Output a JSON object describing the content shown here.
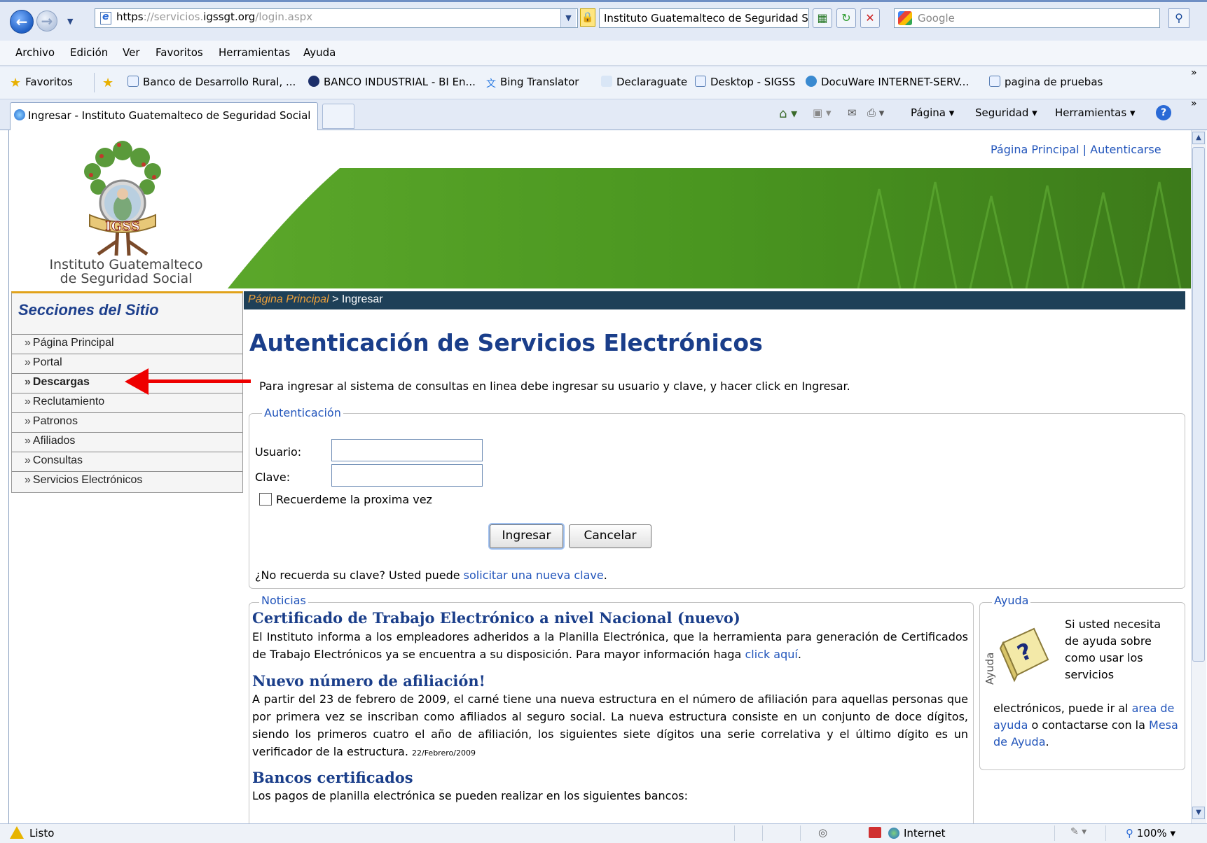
{
  "browser": {
    "address": {
      "scheme": "https",
      "sep": "://",
      "host_prefix": "servicios.",
      "domain": "igssgt.org",
      "path": "/login.aspx"
    },
    "site_title": "Instituto Guatemalteco de Seguridad S...",
    "search_placeholder": "Google",
    "menu": [
      "Archivo",
      "Edición",
      "Ver",
      "Favoritos",
      "Herramientas",
      "Ayuda"
    ],
    "favorites_label": "Favoritos",
    "favorites": [
      "Banco de Desarrollo Rural, ...",
      "BANCO INDUSTRIAL - BI En...",
      "Bing Translator",
      "Declaraguate",
      "Desktop - SIGSS",
      "DocuWare INTERNET-SERV...",
      "pagina de pruebas"
    ],
    "tab_title": "Ingresar - Instituto Guatemalteco de Seguridad Social",
    "commands": {
      "pagina": "Página ▾",
      "seguridad": "Seguridad ▾",
      "herramientas": "Herramientas ▾"
    },
    "status": {
      "text": "Listo",
      "zone": "Internet",
      "zoom": "100%"
    }
  },
  "header": {
    "logo_text": "IGSS",
    "org_name_line1": "Instituto Guatemalteco",
    "org_name_line2": "de Seguridad Social",
    "top_link_home": "Página Principal",
    "top_link_sep": "|",
    "top_link_auth": "Autenticarse"
  },
  "sidebar": {
    "title": "Secciones del Sitio",
    "marker": "»",
    "items": [
      {
        "label": "Página Principal",
        "bold": false
      },
      {
        "label": "Portal",
        "bold": false
      },
      {
        "label": "Descargas",
        "bold": true
      },
      {
        "label": "Reclutamiento",
        "bold": false
      },
      {
        "label": "Patronos",
        "bold": false
      },
      {
        "label": "Afiliados",
        "bold": false
      },
      {
        "label": "Consultas",
        "bold": false
      },
      {
        "label": "Servicios Electrónicos",
        "bold": false
      }
    ]
  },
  "breadcrumb": {
    "home": "Página Principal",
    "sep": ">",
    "current": "Ingresar"
  },
  "main": {
    "title": "Autenticación de Servicios Electrónicos",
    "intro": "Para ingresar al sistema de consultas en linea debe ingresar su usuario y clave, y hacer click en Ingresar.",
    "auth_legend": "Autenticación",
    "usuario_label": "Usuario:",
    "usuario_value": "",
    "clave_label": "Clave:",
    "clave_value": "",
    "remember_label": "Recuerdeme la proxima vez",
    "remember_checked": false,
    "btn_login": "Ingresar",
    "btn_cancel": "Cancelar",
    "forgot_prefix": "¿No recuerda su clave? Usted puede ",
    "forgot_link": "solicitar una nueva clave",
    "forgot_suffix": "."
  },
  "news": {
    "legend": "Noticias",
    "items": [
      {
        "title": "Certificado de Trabajo Electrónico a nivel Nacional (nuevo)",
        "body": "El Instituto informa a los empleadores adheridos a la Planilla Electrónica, que la herramienta para generación de Certificados de Trabajo Electrónicos ya se encuentra a su disposición. Para mayor información haga ",
        "link": "click aquí",
        "suffix": "."
      },
      {
        "title": "Nuevo número de afiliación!",
        "body": "A partir del 23 de febrero de 2009, el carné tiene una nueva estructura en el número de afiliación para aquellas personas que por primera vez se inscriban como afiliados al seguro social. La nueva estructura consiste en un conjunto de doce dígitos, siendo los primeros cuatro el año de afiliación, los siguientes siete dígitos una serie correlativa y el último dígito es un verificador de la estructura.",
        "date": "22/Febrero/2009"
      },
      {
        "title": "Bancos certificados",
        "body": "Los pagos de planilla electrónica se pueden realizar en los siguientes bancos:"
      }
    ]
  },
  "help": {
    "legend": "Ayuda",
    "book_label": "Ayuda",
    "text_top": "Si usted necesita de ayuda sobre como usar los servicios",
    "text_mid": "electrónicos, puede ir al ",
    "link_area": "area de ayuda",
    "text_or": " o contactarse con la ",
    "link_mesa": "Mesa de Ayuda",
    "text_end": "."
  },
  "colors": {
    "link": "#2255bb",
    "title_blue": "#1a3e8a",
    "breadcrumb_bg": "#1e4058",
    "breadcrumb_home": "#f0a13a",
    "sidebar_accent": "#e1a21a",
    "annotation_arrow": "#ee0000"
  },
  "icons": [
    "back-icon",
    "forward-icon",
    "ie-page-icon",
    "lock-icon",
    "rss-icon",
    "refresh-icon",
    "stop-icon",
    "search-icon",
    "star-icon",
    "home-icon",
    "feed-icon",
    "mail-icon",
    "print-icon",
    "help-icon",
    "warning-icon",
    "globe-icon"
  ]
}
